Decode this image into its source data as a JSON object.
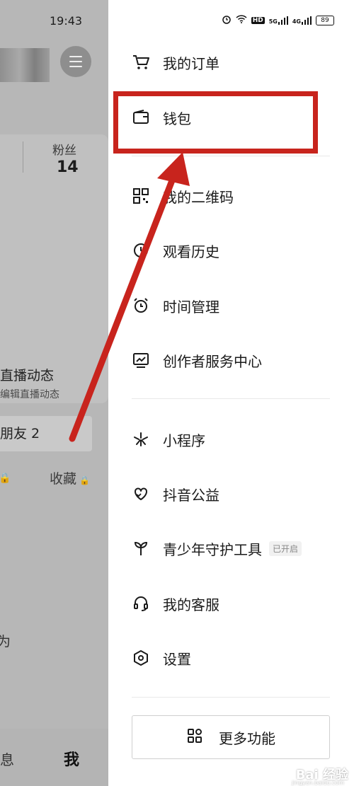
{
  "background": {
    "time": "19:43",
    "fans_label": "粉丝",
    "fans_count": "14",
    "live_title": "直播动态",
    "live_sub": "编辑直播动态",
    "friends": "朋友 2",
    "collect": "收藏",
    "fragment": "为",
    "tab_messages": "息",
    "tab_me": "我"
  },
  "status_bar": {
    "hd": "HD",
    "net1": "5G",
    "net2": "4G",
    "battery": "89"
  },
  "drawer": {
    "items": [
      {
        "label": "我的订单",
        "icon": "cart-icon"
      },
      {
        "label": "钱包",
        "icon": "wallet-icon"
      },
      {
        "label": "我的二维码",
        "icon": "qr-code-icon"
      },
      {
        "label": "观看历史",
        "icon": "history-icon"
      },
      {
        "label": "时间管理",
        "icon": "alarm-clock-icon"
      },
      {
        "label": "创作者服务中心",
        "icon": "creator-chart-icon"
      },
      {
        "label": "小程序",
        "icon": "mini-program-icon"
      },
      {
        "label": "抖音公益",
        "icon": "charity-heart-icon"
      },
      {
        "label": "青少年守护工具",
        "icon": "sprout-icon",
        "badge": "已开启"
      },
      {
        "label": "我的客服",
        "icon": "headset-icon"
      },
      {
        "label": "设置",
        "icon": "settings-hexagon-icon"
      }
    ],
    "more_label": "更多功能"
  },
  "watermark": {
    "text": "Bai 经验",
    "sub": "jingyan.baidu.com"
  },
  "colors": {
    "annotation_red": "#c8241d",
    "overlay_gray": "#b7b7b7"
  }
}
